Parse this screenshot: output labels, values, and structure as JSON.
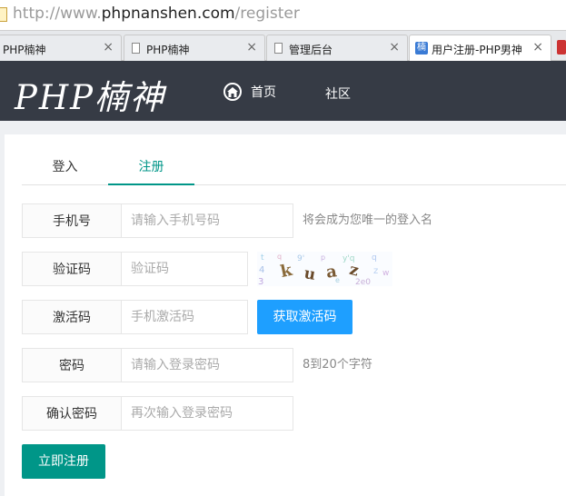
{
  "browser": {
    "url_prefix": "http://www.",
    "url_host": "phpnanshen.com",
    "url_path": "/register",
    "tabs": [
      {
        "title": "PHP楠神",
        "close": "×"
      },
      {
        "title": "PHP楠神",
        "close": "×"
      },
      {
        "title": "管理后台",
        "close": "×"
      },
      {
        "title": "用户注册-PHP男神",
        "close": "×",
        "favicon": "楠"
      }
    ]
  },
  "header": {
    "logo": "PHP楠神",
    "nav": [
      {
        "label": "首页",
        "icon": "home-icon"
      },
      {
        "label": "社区"
      }
    ]
  },
  "form": {
    "tabs": [
      "登入",
      "注册"
    ],
    "active_tab": "注册",
    "fields": {
      "phone": {
        "label": "手机号",
        "placeholder": "请输入手机号码",
        "hint": "将会成为您唯一的登入名"
      },
      "captcha": {
        "label": "验证码",
        "placeholder": "验证码"
      },
      "activation": {
        "label": "激活码",
        "placeholder": "手机激活码",
        "button": "获取激活码"
      },
      "password": {
        "label": "密码",
        "placeholder": "请输入登录密码",
        "hint": "8到20个字符"
      },
      "confirm": {
        "label": "确认密码",
        "placeholder": "再次输入登录密码"
      }
    },
    "submit": "立即注册"
  },
  "colors": {
    "header_bg": "#363b45",
    "accent_green": "#009688",
    "accent_blue": "#1e9fff"
  }
}
